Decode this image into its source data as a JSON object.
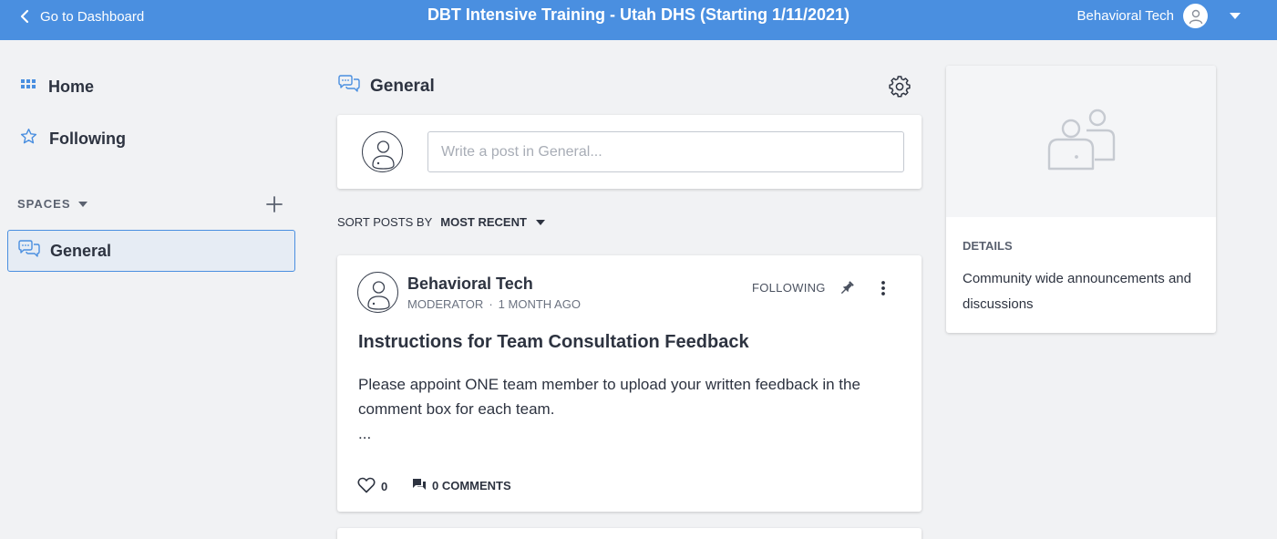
{
  "header": {
    "back_label": "Go to Dashboard",
    "course_title": "DBT Intensive Training - Utah DHS (Starting 1/11/2021)",
    "user_name": "Behavioral Tech"
  },
  "sidebar": {
    "nav": [
      {
        "label": "Home",
        "icon": "grid-icon"
      },
      {
        "label": "Following",
        "icon": "star-icon"
      }
    ],
    "spaces_label": "SPACES",
    "spaces": [
      {
        "label": "General",
        "icon": "chat-bubbles-icon",
        "active": true
      }
    ]
  },
  "main": {
    "space_title": "General",
    "composer": {
      "placeholder": "Write a post in General..."
    },
    "sort": {
      "label": "SORT POSTS BY",
      "value": "MOST RECENT"
    },
    "posts": [
      {
        "author": "Behavioral Tech",
        "role": "MODERATOR",
        "separator": "·",
        "time": "1 MONTH AGO",
        "follow_status": "FOLLOWING",
        "pinned": true,
        "title": "Instructions for Team Consultation Feedback",
        "body": "Please appoint ONE team member to upload your written feedback in the comment box for each team.",
        "ellipsis": "...",
        "likes": "0",
        "comments": "0 COMMENTS"
      }
    ]
  },
  "details": {
    "label": "DETAILS",
    "text": "Community wide announcements and discussions"
  },
  "colors": {
    "brand": "#4a8fe0",
    "background": "#f1f2f4",
    "text": "#2d3340"
  }
}
